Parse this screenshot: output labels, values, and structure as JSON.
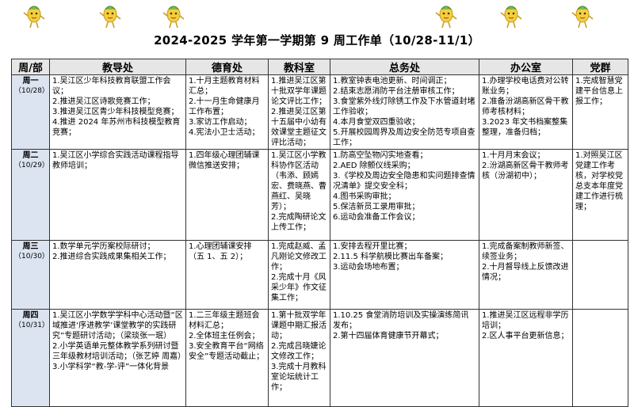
{
  "title": "2024-2025 学年第一学期第 9 周工作单（10/28-11/1）",
  "header_mascots": [
    "mascot-icon",
    "mascot-icon",
    "mascot-icon",
    "mascot-icon",
    "mascot-icon",
    "mascot-icon"
  ],
  "columns": [
    "周/部",
    "教导处",
    "德育处",
    "教科室",
    "总务处",
    "办公室",
    "党群"
  ],
  "days": [
    {
      "name": "周一",
      "date": "（10/28）",
      "cells": [
        [
          "1.吴江区少年科技教育联盟工作会议；",
          "2.推进吴江区诗歌竞赛工作；",
          "3.推进吴江区青少年科技模型竞赛；",
          "4.推进 2024 年苏州市科技模型教育竞赛；"
        ],
        [
          "1.十月主题教育材料汇总；",
          "2.十一月生命健康月工作布置；",
          "3.家访工作启动；",
          "4.宪法小卫士活动；"
        ],
        [
          "1.推进吴江区第十批双学年课题论文评比工作；",
          "2.推进吴江区第十五届中小幼有效课堂主题征文评比活动；"
        ],
        [
          "1.教室钟表电池更新、时间调正；",
          "2.结束志愿消防平台注册审核工作；",
          "3.食堂紫外线灯除锈工作及下水管道封堵工作验收；",
          "4.本月食堂双四重验收；",
          "5.开展校园周界及周边安全防范专项自查工作；"
        ],
        [
          "1.办理学校电话费对公转账业务；",
          "2.准备汾湖高新区骨干教师考核材料；",
          "3.2023 年文书档案整集整理，准备归档；"
        ],
        [
          "1.完成智慧党建平台信息上报工作；"
        ]
      ]
    },
    {
      "name": "周二",
      "date": "（10/29）",
      "cells": [
        [
          "1.吴江区小学综合实践活动课程指导教师培训；"
        ],
        [
          "1.四年级心理团辅课微信推送安排；"
        ],
        [
          "1.吴江区小学教科协作区活动（韦添、顾嫣宏、费晓燕、曹燕红、吴晓芳）；",
          "2.完成陶研论文上传工作；"
        ],
        [
          "1.防高空坠物闪实地查看；",
          "2.AED 除颤仪线采购；",
          "3.《学校及周边安全隐患和实问题排查情况清单》提交安全科；",
          "4.图书采购审批；",
          "5.保洁新员工录用审批；",
          "6.运动会准备工作会议；"
        ],
        [
          "1.十月月末会议；",
          "2.汾湖高新区骨干教师考核（汾湖初中）；"
        ],
        [
          "1.对照吴江区党建工作考核，对学校党总支本年度党建工作进行梳理；"
        ]
      ]
    },
    {
      "name": "周三",
      "date": "（10/30）",
      "cells": [
        [
          "1.数学单元学历案校际研讨；",
          "2.推进综合实践成果集相关工作；"
        ],
        [
          "1.心理团辅课安排（五 1、五 2）；"
        ],
        [
          "1.完成赵威、孟凡刚论文修改工作；",
          "2.完成十月《风采少年》作文征集工作；"
        ],
        [
          "1.安排去程开里比赛；",
          "2.11.5 科学航模比赛出车备案；",
          "3.运动会场地布置；"
        ],
        [
          "1.完成备案制教师新签、续签业务；",
          "2.十月督导线上反馈改进情况；"
        ],
        [
          ""
        ]
      ]
    },
    {
      "name": "周四",
      "date": "（10/31）",
      "cells": [
        [
          "1.吴江区小学数学学科中心活动暨“区域推进‘序进教学’课堂教学的实践研究”专题研讨活动；（梁琰张一珉）",
          "2.小学英语单元整体教学系列研讨暨三年级教材培训活动；（张艺婷 周嘉）",
          "3.小学科学“教-学-评”一体化背景"
        ],
        [
          "1.二三年级主题班会材料汇总；",
          "2.全体班主任例会；",
          "3.安全教育平台“网络安全”专题活动截止；"
        ],
        [
          "1.第十批双学年课题中期汇报活动；",
          "2.完成吕晓婕论文修改工作；",
          "3.完成十月教科室论坛统计工作；"
        ],
        [
          "1.10.25 食堂消防培训及实操演练简讯发布；",
          "2.第十四届体育健康节开幕式；"
        ],
        [
          "1.推进吴江区远程非学历培训；",
          "2.区人事平台更新信息；"
        ],
        [
          ""
        ]
      ]
    }
  ]
}
